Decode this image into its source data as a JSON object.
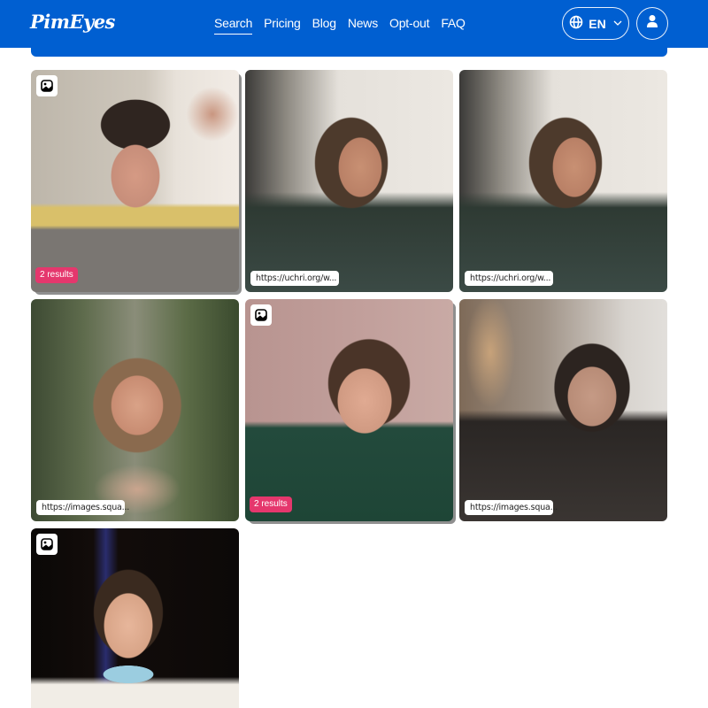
{
  "header": {
    "logo": "PimEyes",
    "nav": [
      {
        "label": "Search",
        "active": true
      },
      {
        "label": "Pricing",
        "active": false
      },
      {
        "label": "Blog",
        "active": false
      },
      {
        "label": "News",
        "active": false
      },
      {
        "label": "Opt-out",
        "active": false
      },
      {
        "label": "FAQ",
        "active": false
      }
    ],
    "language": {
      "icon": "globe-icon",
      "label": "EN",
      "chevron": "chevron-down-icon"
    },
    "account": {
      "icon": "user-icon"
    }
  },
  "colors": {
    "brand": "#005fd1",
    "results_badge": "#e5376d",
    "chip_bg": "#ffffff"
  },
  "results": [
    {
      "image_icon": true,
      "badge": "2 results",
      "url": null,
      "stacked": true
    },
    {
      "image_icon": false,
      "badge": null,
      "url": "https://uchri.org/w...",
      "stacked": false
    },
    {
      "image_icon": false,
      "badge": null,
      "url": "https://uchri.org/w...",
      "stacked": false
    },
    {
      "image_icon": false,
      "badge": null,
      "url": "https://images.squa...",
      "stacked": false
    },
    {
      "image_icon": true,
      "badge": "2 results",
      "url": null,
      "stacked": true
    },
    {
      "image_icon": false,
      "badge": null,
      "url": "https://images.squa...",
      "stacked": false
    },
    {
      "image_icon": true,
      "badge": null,
      "url": null,
      "stacked": false
    }
  ]
}
